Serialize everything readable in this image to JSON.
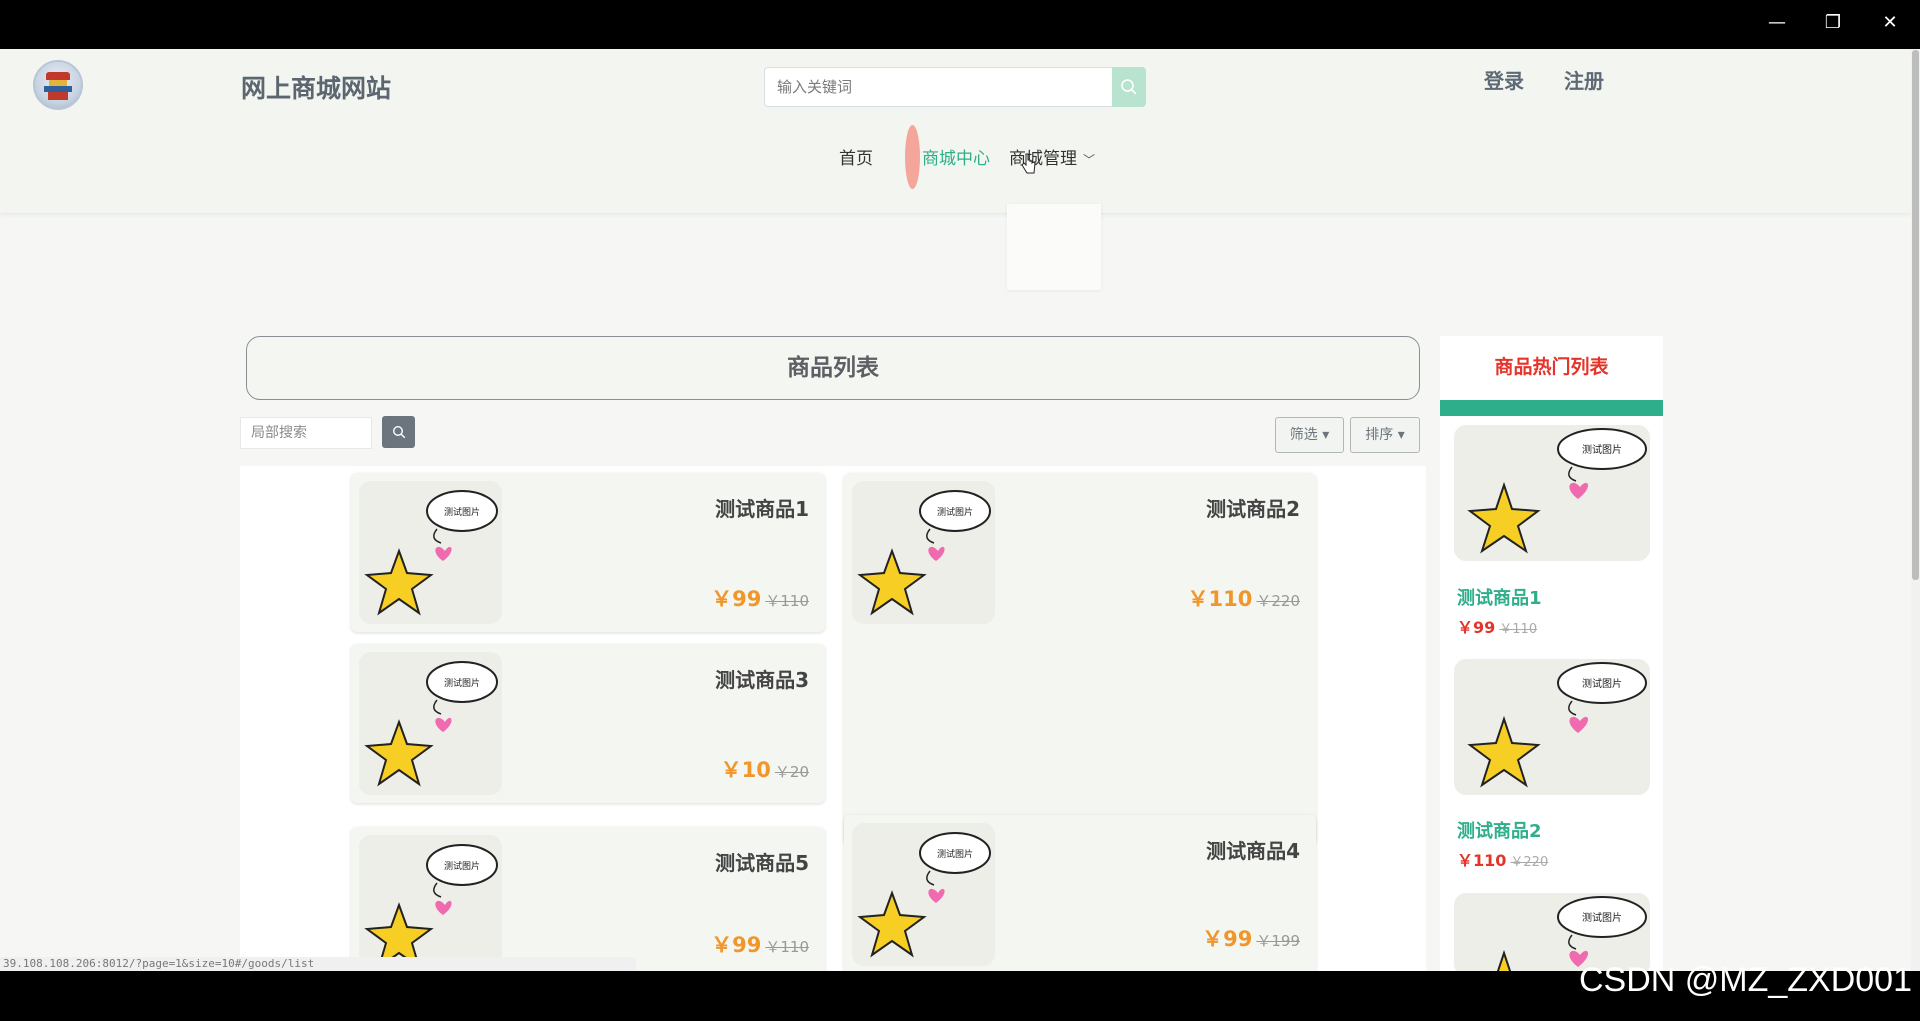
{
  "window": {
    "minimize": "—",
    "restore": "❐",
    "close": "✕"
  },
  "header": {
    "site_title": "网上商城网站",
    "search_placeholder": "输入关键词",
    "login": "登录",
    "register": "注册",
    "nav": {
      "home": "首页",
      "mall_center": "商城中心",
      "mall_manage": "商城管理"
    }
  },
  "main": {
    "list_title": "商品列表",
    "local_search_placeholder": "局部搜索",
    "filter": "筛选",
    "sort": "排序",
    "products": [
      {
        "name": "测试商品1",
        "price": "￥99",
        "old_price": "￥110",
        "image_text": "测试图片"
      },
      {
        "name": "测试商品2",
        "price": "￥110",
        "old_price": "￥220",
        "image_text": "测试图片"
      },
      {
        "name": "测试商品3",
        "price": "￥10",
        "old_price": "￥20",
        "image_text": "测试图片"
      },
      {
        "name": "测试商品5",
        "price": "￥99",
        "old_price": "￥110",
        "image_text": "测试图片"
      },
      {
        "name": "测试商品4",
        "price": "￥99",
        "old_price": "￥199",
        "image_text": "测试图片"
      }
    ]
  },
  "hot": {
    "title": "商品热门列表",
    "items": [
      {
        "name": "测试商品1",
        "price": "￥99",
        "old_price": "￥110",
        "image_text": "测试图片"
      },
      {
        "name": "测试商品2",
        "price": "￥110",
        "old_price": "￥220",
        "image_text": "测试图片"
      },
      {
        "image_text": "测试图片"
      }
    ]
  },
  "status_url": "39.108.108.206:8012/?page=1&size=10#/goods/list",
  "watermark": "CSDN @MZ_ZXD001",
  "colors": {
    "accent": "#2fae8c",
    "price": "#f0962a",
    "hot_red": "#e5342a"
  }
}
